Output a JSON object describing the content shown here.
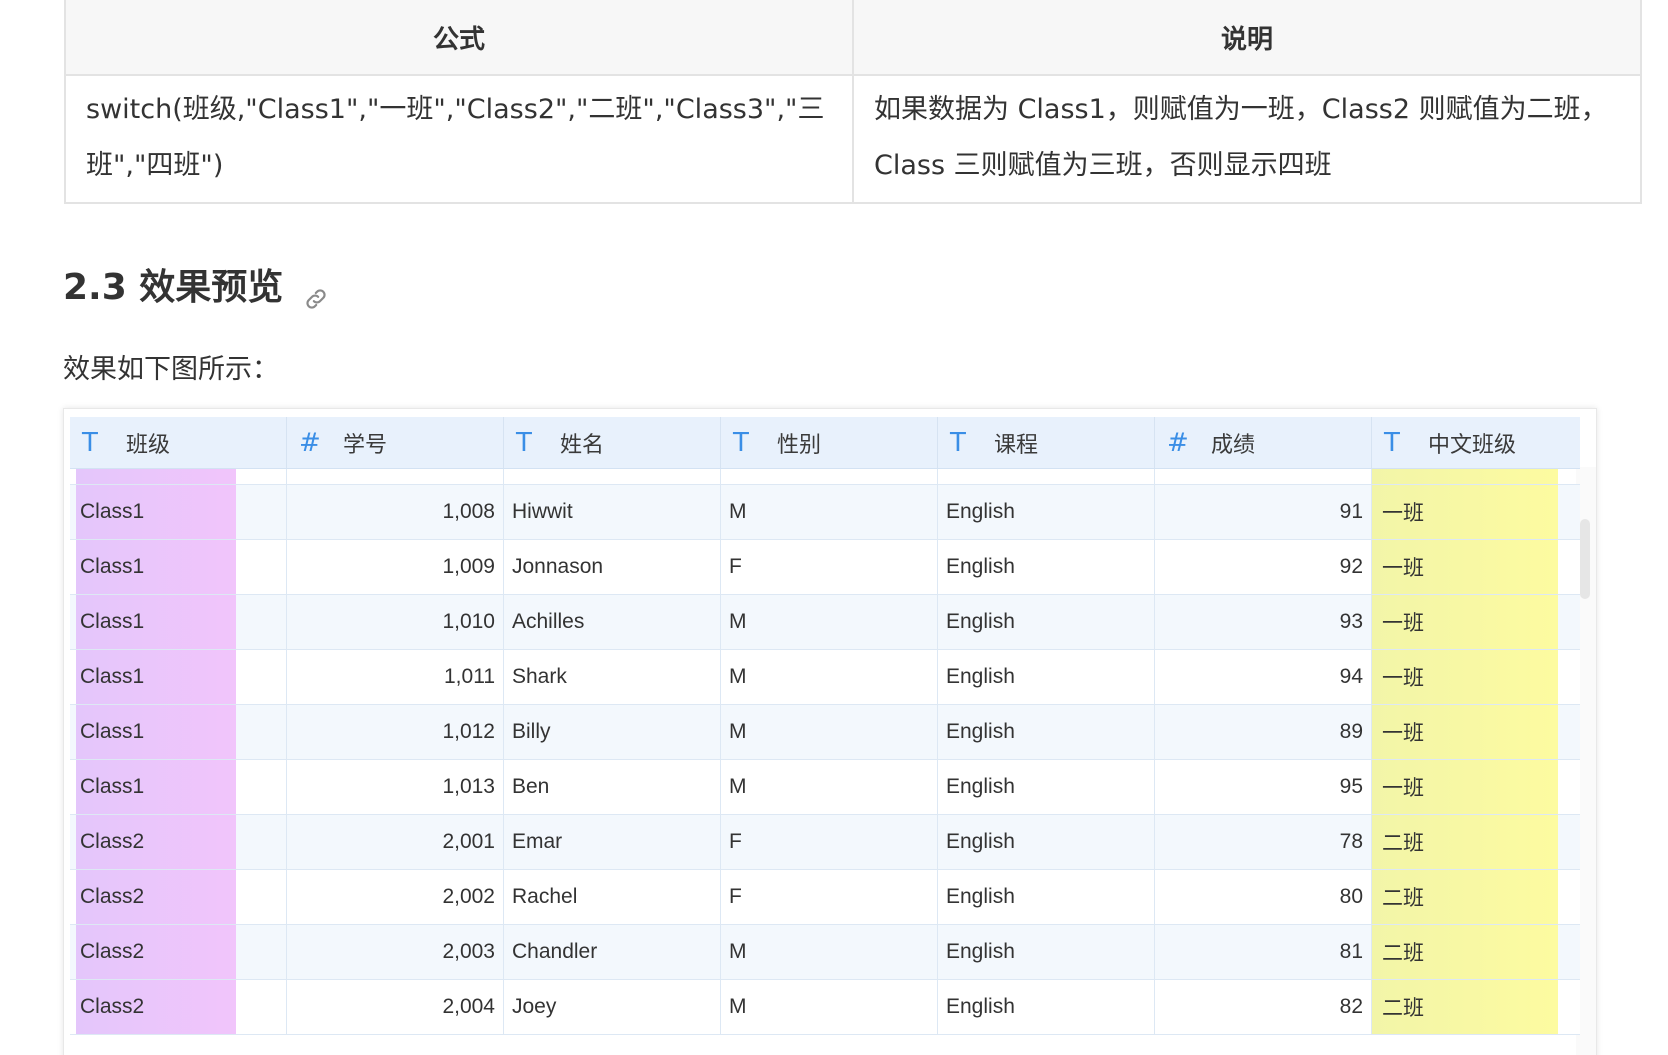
{
  "formula_table": {
    "headers": [
      "公式",
      "说明"
    ],
    "row": {
      "formula": "switch(班级,\"Class1\",\"一班\",\"Class2\",\"二班\",\"Class3\",\"三班\",\"四班\")",
      "description": "如果数据为 Class1，则赋值为一班，Class2 则赋值为二班，Class 三则赋值为三班，否则显示四班"
    }
  },
  "heading": {
    "title": "2.3 效果预览",
    "anchor_icon": "link-icon"
  },
  "intro_text": "效果如下图所示：",
  "preview": {
    "columns": [
      {
        "type_icon": "T",
        "label": "班级"
      },
      {
        "type_icon": "#",
        "label": "学号"
      },
      {
        "type_icon": "T",
        "label": "姓名"
      },
      {
        "type_icon": "T",
        "label": "性别"
      },
      {
        "type_icon": "T",
        "label": "课程"
      },
      {
        "type_icon": "#",
        "label": "成绩"
      },
      {
        "type_icon": "T",
        "label": "中文班级"
      }
    ],
    "rows": [
      {
        "class": "Class1",
        "id": "1,008",
        "name": "Hiwwit",
        "gender": "M",
        "course": "English",
        "score": "91",
        "cn_class": "一班"
      },
      {
        "class": "Class1",
        "id": "1,009",
        "name": "Jonnason",
        "gender": "F",
        "course": "English",
        "score": "92",
        "cn_class": "一班"
      },
      {
        "class": "Class1",
        "id": "1,010",
        "name": "Achilles",
        "gender": "M",
        "course": "English",
        "score": "93",
        "cn_class": "一班"
      },
      {
        "class": "Class1",
        "id": "1,011",
        "name": "Shark",
        "gender": "M",
        "course": "English",
        "score": "94",
        "cn_class": "一班"
      },
      {
        "class": "Class1",
        "id": "1,012",
        "name": "Billy",
        "gender": "M",
        "course": "English",
        "score": "89",
        "cn_class": "一班"
      },
      {
        "class": "Class1",
        "id": "1,013",
        "name": "Ben",
        "gender": "M",
        "course": "English",
        "score": "95",
        "cn_class": "一班"
      },
      {
        "class": "Class2",
        "id": "2,001",
        "name": "Emar",
        "gender": "F",
        "course": "English",
        "score": "78",
        "cn_class": "二班"
      },
      {
        "class": "Class2",
        "id": "2,002",
        "name": "Rachel",
        "gender": "F",
        "course": "English",
        "score": "80",
        "cn_class": "二班"
      },
      {
        "class": "Class2",
        "id": "2,003",
        "name": "Chandler",
        "gender": "M",
        "course": "English",
        "score": "81",
        "cn_class": "二班"
      },
      {
        "class": "Class2",
        "id": "2,004",
        "name": "Joey",
        "gender": "M",
        "course": "English",
        "score": "82",
        "cn_class": "二班"
      }
    ],
    "colors": {
      "header_bg": "#e8f1fc",
      "type_icon": "#3a8ee6",
      "class_highlight": "#e4c6fb",
      "cn_class_highlight": "#fdfba0"
    }
  }
}
